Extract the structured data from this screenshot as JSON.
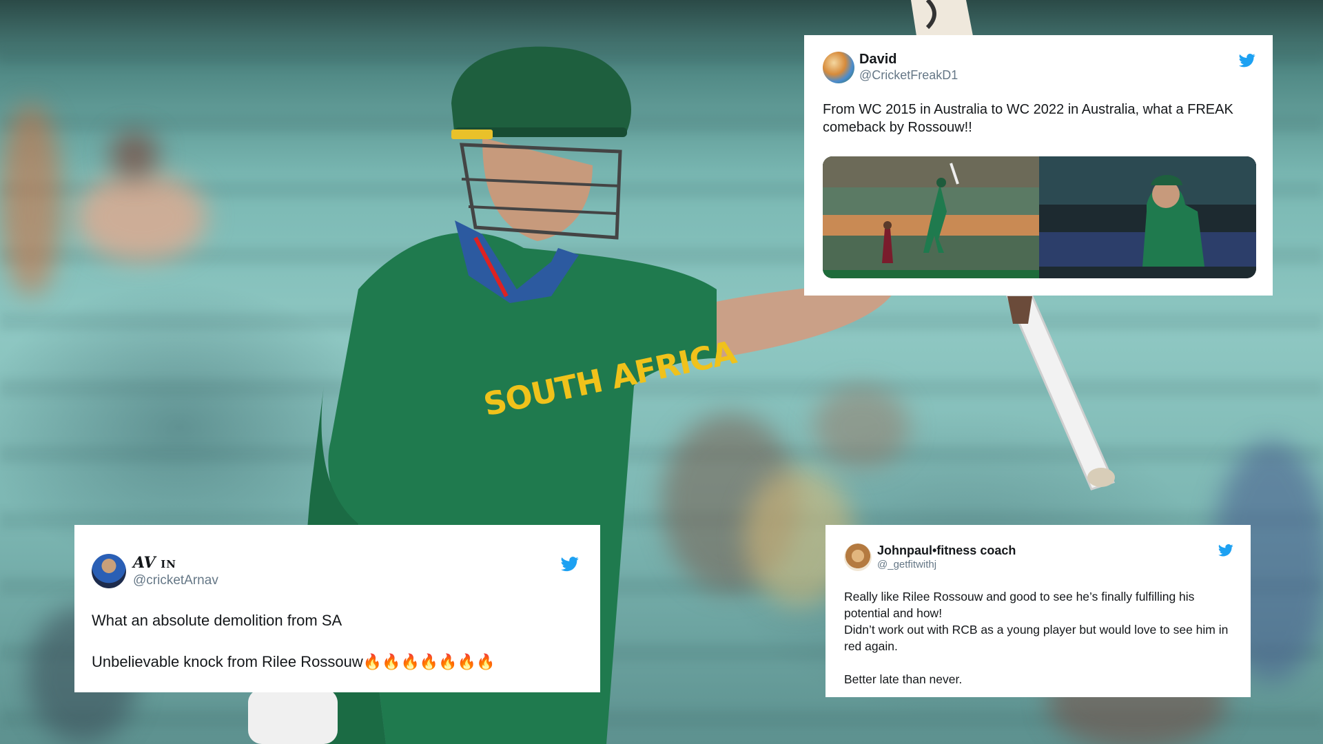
{
  "scene": {
    "jersey_text": "SOUTH AFRICA",
    "colors": {
      "jersey_green": "#1f7a4e",
      "jersey_yellow": "#f0c21b",
      "stand_teal": "#86c2bd",
      "twitter_blue": "#1da1f2"
    }
  },
  "tweets": [
    {
      "name": "David",
      "handle": "@CricketFreakD1",
      "text": "From WC 2015 in Australia to WC 2022 in Australia, what a FREAK comeback by Rossouw!!",
      "icon": "twitter-bird-icon"
    },
    {
      "name": "AV",
      "name_suffix": "IN",
      "handle": "@cricketArnav",
      "text": "What an absolute demolition from SA\n\nUnbelievable knock from Rilee Rossouw🔥🔥🔥🔥🔥🔥🔥",
      "icon": "twitter-bird-icon"
    },
    {
      "name": "Johnpaul•fitness coach",
      "handle": "@_getfitwithj",
      "text": "Really like Rilee Rossouw and good to see he’s finally fulfilling his potential and how!\nDidn’t work out with RCB as a young player but would love to see him in red again.\n\nBetter late than never.",
      "icon": "twitter-bird-icon"
    }
  ]
}
